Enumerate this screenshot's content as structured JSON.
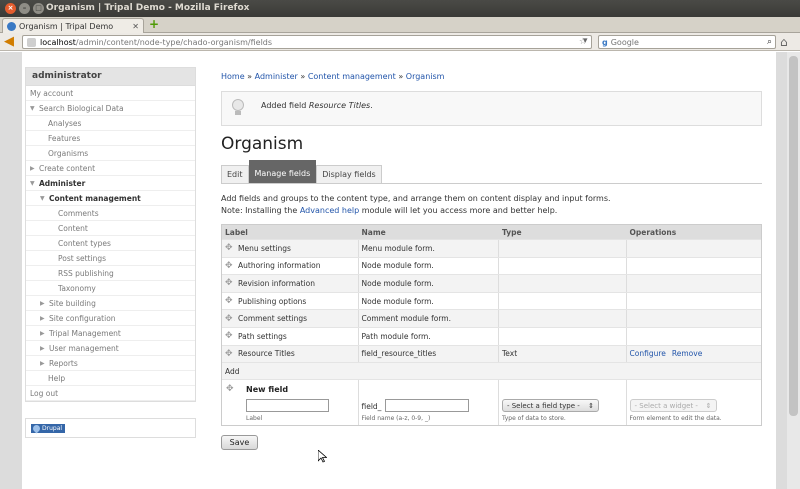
{
  "window": {
    "title": "Organism | Tripal Demo - Mozilla Firefox",
    "tab_title": "Organism | Tripal Demo"
  },
  "navbar": {
    "url_host": "localhost",
    "url_path": "/admin/content/node-type/chado-organism/fields",
    "search_placeholder": "Google",
    "search_engine": "g"
  },
  "sidebar": {
    "header": "administrator",
    "items": [
      {
        "label": "My account",
        "level": 0,
        "arrow": ""
      },
      {
        "label": "Search Biological Data",
        "level": 0,
        "arrow": "▼"
      },
      {
        "label": "Analyses",
        "level": 1,
        "arrow": ""
      },
      {
        "label": "Features",
        "level": 1,
        "arrow": ""
      },
      {
        "label": "Organisms",
        "level": 1,
        "arrow": ""
      },
      {
        "label": "Create content",
        "level": 0,
        "arrow": "▶"
      },
      {
        "label": "Administer",
        "level": 0,
        "arrow": "▼",
        "bold": true
      },
      {
        "label": "Content management",
        "level": 1,
        "arrow": "▼",
        "bold": true
      },
      {
        "label": "Comments",
        "level": 2,
        "arrow": ""
      },
      {
        "label": "Content",
        "level": 2,
        "arrow": ""
      },
      {
        "label": "Content types",
        "level": 2,
        "arrow": ""
      },
      {
        "label": "Post settings",
        "level": 2,
        "arrow": ""
      },
      {
        "label": "RSS publishing",
        "level": 2,
        "arrow": ""
      },
      {
        "label": "Taxonomy",
        "level": 2,
        "arrow": ""
      },
      {
        "label": "Site building",
        "level": 1,
        "arrow": "▶"
      },
      {
        "label": "Site configuration",
        "level": 1,
        "arrow": "▶"
      },
      {
        "label": "Tripal Management",
        "level": 1,
        "arrow": "▶"
      },
      {
        "label": "User management",
        "level": 1,
        "arrow": "▶"
      },
      {
        "label": "Reports",
        "level": 1,
        "arrow": "▶"
      },
      {
        "label": "Help",
        "level": 1,
        "arrow": ""
      },
      {
        "label": "Log out",
        "level": 0,
        "arrow": ""
      }
    ],
    "drupal_badge": "Drupal"
  },
  "breadcrumb": {
    "items": [
      "Home",
      "Administer",
      "Content management",
      "Organism"
    ],
    "separator": " » "
  },
  "message": {
    "prefix": "Added field ",
    "field": "Resource Titles",
    "suffix": "."
  },
  "page_title": "Organism",
  "tabs": [
    {
      "label": "Edit",
      "active": false
    },
    {
      "label": "Manage fields",
      "active": true
    },
    {
      "label": "Display fields",
      "active": false
    }
  ],
  "help": {
    "line1": "Add fields and groups to the content type, and arrange them on content display and input forms.",
    "line2_pre": "Note: Installing the ",
    "line2_link": "Advanced help",
    "line2_post": " module will let you access more and better help."
  },
  "table": {
    "headers": [
      "Label",
      "Name",
      "Type",
      "Operations"
    ],
    "rows": [
      {
        "label": "Menu settings",
        "name": "Menu module form.",
        "type": "",
        "ops": []
      },
      {
        "label": "Authoring information",
        "name": "Node module form.",
        "type": "",
        "ops": []
      },
      {
        "label": "Revision information",
        "name": "Node module form.",
        "type": "",
        "ops": []
      },
      {
        "label": "Publishing options",
        "name": "Node module form.",
        "type": "",
        "ops": []
      },
      {
        "label": "Comment settings",
        "name": "Comment module form.",
        "type": "",
        "ops": []
      },
      {
        "label": "Path settings",
        "name": "Path module form.",
        "type": "",
        "ops": []
      },
      {
        "label": "Resource Titles",
        "name": "field_resource_titles",
        "type": "Text",
        "ops": [
          "Configure",
          "Remove"
        ]
      }
    ],
    "add_label": "Add",
    "new_field": {
      "title": "New field",
      "label_desc": "Label",
      "name_prefix": "field_",
      "name_desc": "Field name (a-z, 0-9, _)",
      "type_select": "- Select a field type -",
      "type_desc": "Type of data to store.",
      "widget_select": "- Select a widget -",
      "widget_desc": "Form element to edit the data."
    }
  },
  "save_label": "Save"
}
